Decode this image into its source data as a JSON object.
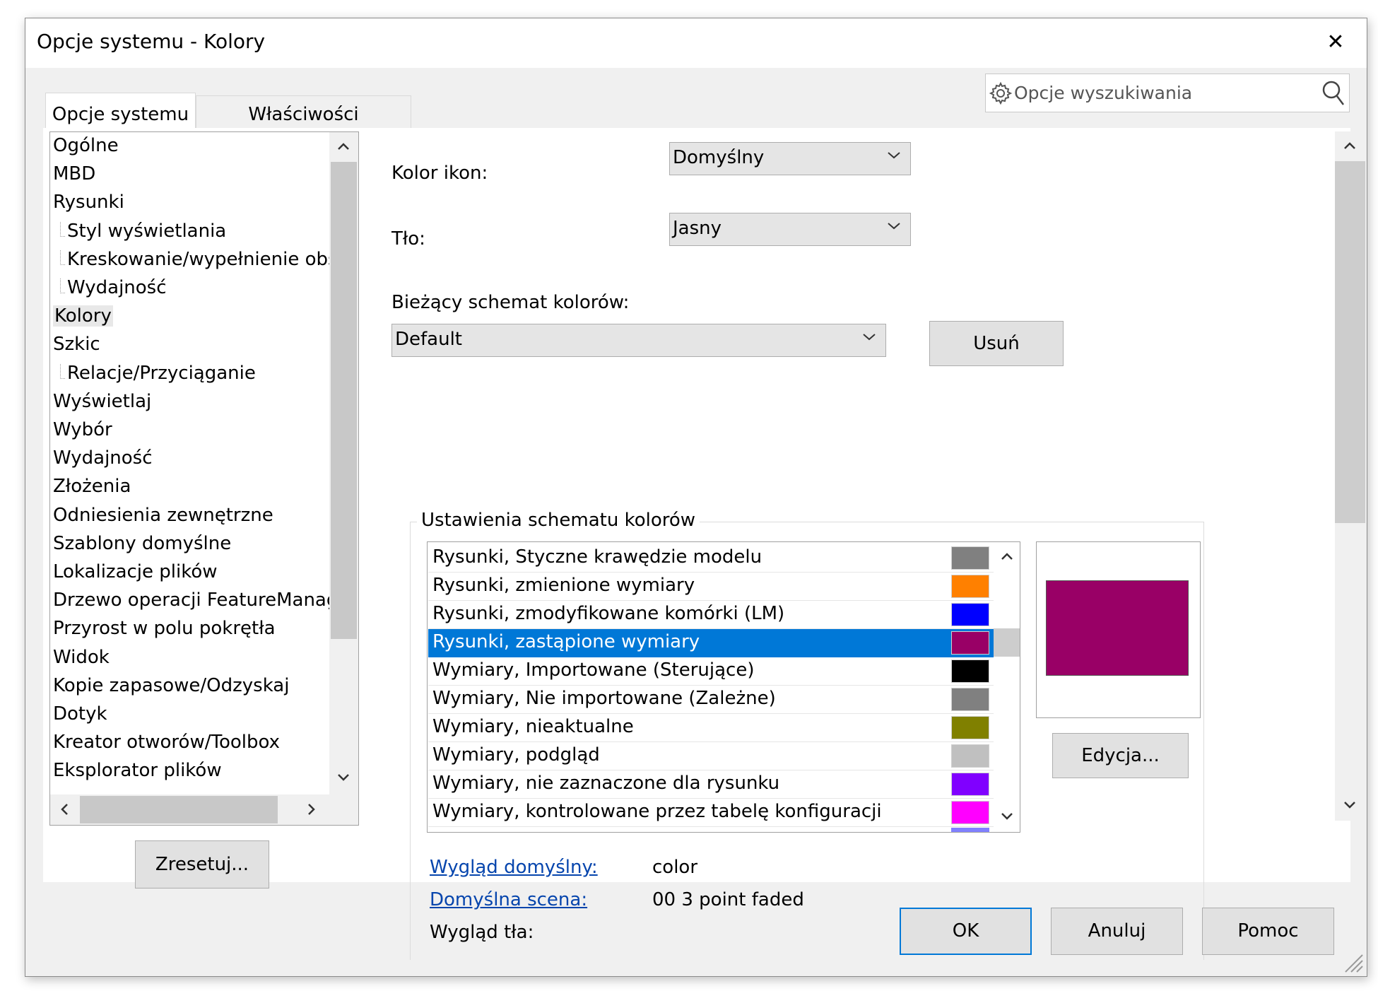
{
  "window": {
    "title": "Opcje systemu - Kolory",
    "close_glyph": "✕"
  },
  "tabs": [
    {
      "label": "Opcje systemu",
      "active": true
    },
    {
      "label": "Właściwości dokumentu",
      "active": false
    }
  ],
  "search": {
    "placeholder": "Opcje wyszukiwania"
  },
  "tree": {
    "items": [
      {
        "label": "Ogólne",
        "level": 0
      },
      {
        "label": "MBD",
        "level": 0
      },
      {
        "label": "Rysunki",
        "level": 0
      },
      {
        "label": "Styl wyświetlania",
        "level": 1
      },
      {
        "label": "Kreskowanie/wypełnienie obsza",
        "level": 1
      },
      {
        "label": "Wydajność",
        "level": 1
      },
      {
        "label": "Kolory",
        "level": 0,
        "selected": true
      },
      {
        "label": "Szkic",
        "level": 0
      },
      {
        "label": "Relacje/Przyciąganie",
        "level": 1
      },
      {
        "label": "Wyświetlaj",
        "level": 0
      },
      {
        "label": "Wybór",
        "level": 0
      },
      {
        "label": "Wydajność",
        "level": 0
      },
      {
        "label": "Złożenia",
        "level": 0
      },
      {
        "label": "Odniesienia zewnętrzne",
        "level": 0
      },
      {
        "label": "Szablony domyślne",
        "level": 0
      },
      {
        "label": "Lokalizacje plików",
        "level": 0
      },
      {
        "label": "Drzewo operacji FeatureManager",
        "level": 0
      },
      {
        "label": "Przyrost w polu pokrętła",
        "level": 0
      },
      {
        "label": "Widok",
        "level": 0
      },
      {
        "label": "Kopie zapasowe/Odzyskaj",
        "level": 0
      },
      {
        "label": "Dotyk",
        "level": 0
      },
      {
        "label": "Kreator otworów/Toolbox",
        "level": 0
      },
      {
        "label": "Eksplorator plików",
        "level": 0
      }
    ]
  },
  "reset_button": "Zresetuj...",
  "icon_color": {
    "label": "Kolor ikon:",
    "value": "Domyślny"
  },
  "background": {
    "label": "Tło:",
    "value": "Jasny"
  },
  "current_scheme": {
    "label": "Bieżący schemat kolorów:",
    "value": "Default",
    "delete_button": "Usuń"
  },
  "scheme_settings": {
    "title": "Ustawienia schematu kolorów",
    "rows": [
      {
        "label": "Rysunki, Styczne krawędzie modelu",
        "color": "#808080"
      },
      {
        "label": "Rysunki, zmienione wymiary",
        "color": "#ff8000"
      },
      {
        "label": "Rysunki, zmodyfikowane komórki (LM)",
        "color": "#0000ff"
      },
      {
        "label": "Rysunki, zastąpione wymiary",
        "color": "#990066",
        "selected": true
      },
      {
        "label": "Wymiary, Importowane (Sterujące)",
        "color": "#000000"
      },
      {
        "label": "Wymiary, Nie importowane (Zależne)",
        "color": "#808080"
      },
      {
        "label": "Wymiary, nieaktualne",
        "color": "#808000"
      },
      {
        "label": "Wymiary, podgląd",
        "color": "#c0c0c0"
      },
      {
        "label": "Wymiary, nie zaznaczone dla rysunku",
        "color": "#8000ff"
      },
      {
        "label": "Wymiary, kontrolowane przez tabelę konfiguracji",
        "color": "#ff00ff"
      }
    ],
    "preview_color": "#990066",
    "edit_button": "Edycja..."
  },
  "appearance": {
    "default_appearance": {
      "label": "Wygląd domyślny:",
      "value": "color"
    },
    "default_scene": {
      "label": "Domyślna scena:",
      "value": "00 3 point faded"
    },
    "background_appearance": {
      "label": "Wygląd tła:"
    }
  },
  "footer": {
    "ok": "OK",
    "cancel": "Anuluj",
    "help": "Pomoc"
  },
  "colors": {
    "selection": "#0078d7",
    "link": "#0645ad",
    "dialog_bg": "#f0f0f0",
    "default_button_border": "#0078d7"
  }
}
